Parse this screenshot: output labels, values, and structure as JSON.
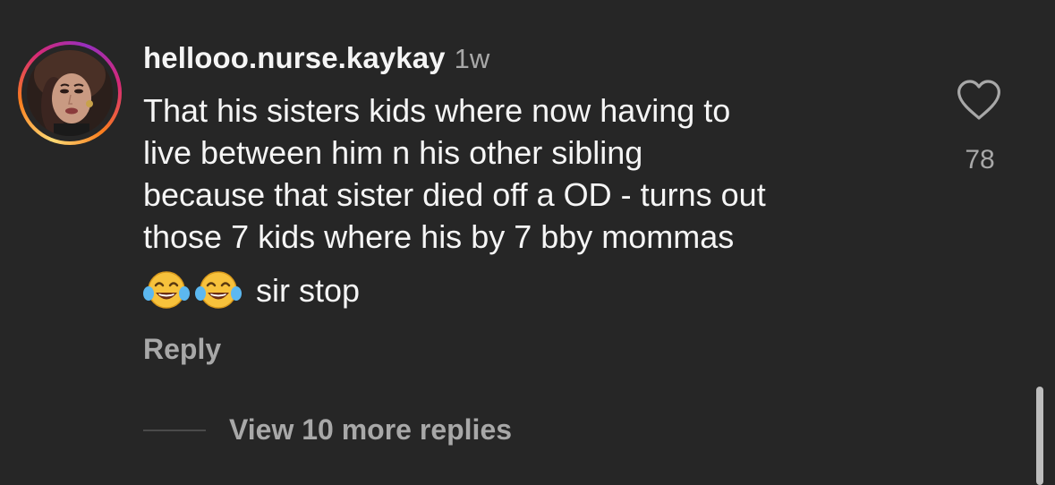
{
  "comment": {
    "username": "hellooo.nurse.kaykay",
    "timestamp": "1w",
    "text_lines": [
      "That his sisters kids where now having to",
      "live between him n his other sibling",
      "because that sister died off a OD - turns out",
      "those 7 kids where his by 7 bby mommas"
    ],
    "emoji_text": "sir stop",
    "emojis": [
      "face-with-tears-of-joy-icon",
      "face-with-tears-of-joy-icon"
    ],
    "reply_label": "Reply",
    "like_icon": "heart-outline-icon",
    "like_count": "78",
    "view_replies_label": "View 10 more replies"
  },
  "colors": {
    "background": "#262626",
    "primary_text": "#f5f5f5",
    "secondary_text": "#a8a8a8",
    "story_ring_start": "#feda75",
    "story_ring_end": "#d62976"
  }
}
